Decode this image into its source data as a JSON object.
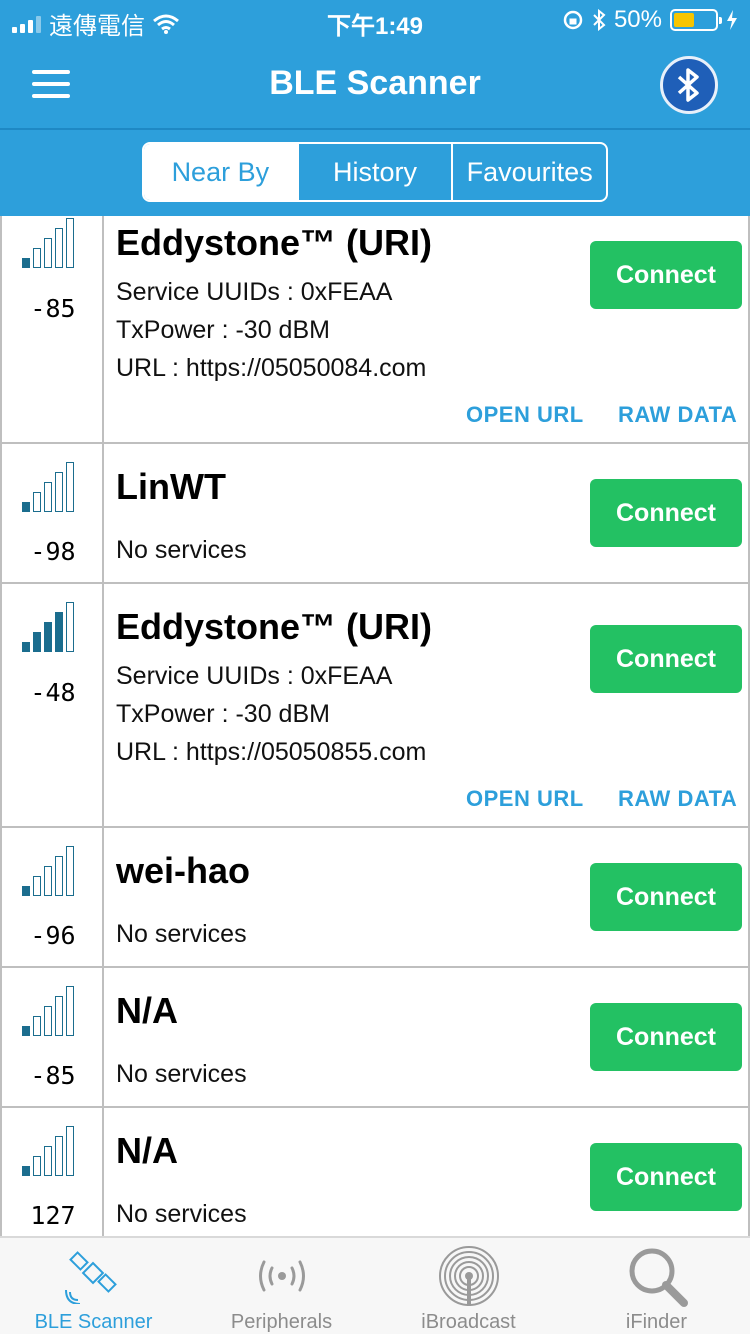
{
  "status": {
    "carrier": "遠傳電信",
    "time": "下午1:49",
    "battery": "50%",
    "battery_level": 0.5
  },
  "nav": {
    "title": "BLE Scanner"
  },
  "segments": [
    "Near By",
    "History",
    "Favourites"
  ],
  "devices": [
    {
      "rssi": "-85",
      "bars": 1,
      "name": "Eddystone™ (URI)",
      "lines": [
        "Service UUIDs : 0xFEAA",
        "TxPower : -30 dBM",
        "URL : https://05050084.com"
      ],
      "connect": "Connect",
      "open_url": "OPEN URL",
      "raw_data": "RAW DATA"
    },
    {
      "rssi": "-98",
      "bars": 1,
      "name": "LinWT",
      "lines": [
        "No services"
      ],
      "connect": "Connect"
    },
    {
      "rssi": "-48",
      "bars": 4,
      "name": "Eddystone™ (URI)",
      "lines": [
        "Service UUIDs : 0xFEAA",
        "TxPower : -30 dBM",
        "URL : https://05050855.com"
      ],
      "connect": "Connect",
      "open_url": "OPEN URL",
      "raw_data": "RAW DATA"
    },
    {
      "rssi": "-96",
      "bars": 1,
      "name": "wei-hao",
      "lines": [
        "No services"
      ],
      "connect": "Connect"
    },
    {
      "rssi": "-85",
      "bars": 1,
      "name": "N/A",
      "lines": [
        "No services"
      ],
      "connect": "Connect"
    },
    {
      "rssi": "127",
      "bars": 1,
      "name": "N/A",
      "lines": [
        "No services"
      ],
      "connect": "Connect"
    }
  ],
  "tabs": [
    {
      "label": "BLE Scanner",
      "icon": "satellite-icon",
      "active": true
    },
    {
      "label": "Peripherals",
      "icon": "broadcast-waves-icon",
      "active": false
    },
    {
      "label": "iBroadcast",
      "icon": "ibroadcast-icon",
      "active": false
    },
    {
      "label": "iFinder",
      "icon": "magnifier-icon",
      "active": false
    }
  ],
  "colors": {
    "primary": "#2d9fdb",
    "connect": "#23c163",
    "signal": "#1b6d8e"
  }
}
